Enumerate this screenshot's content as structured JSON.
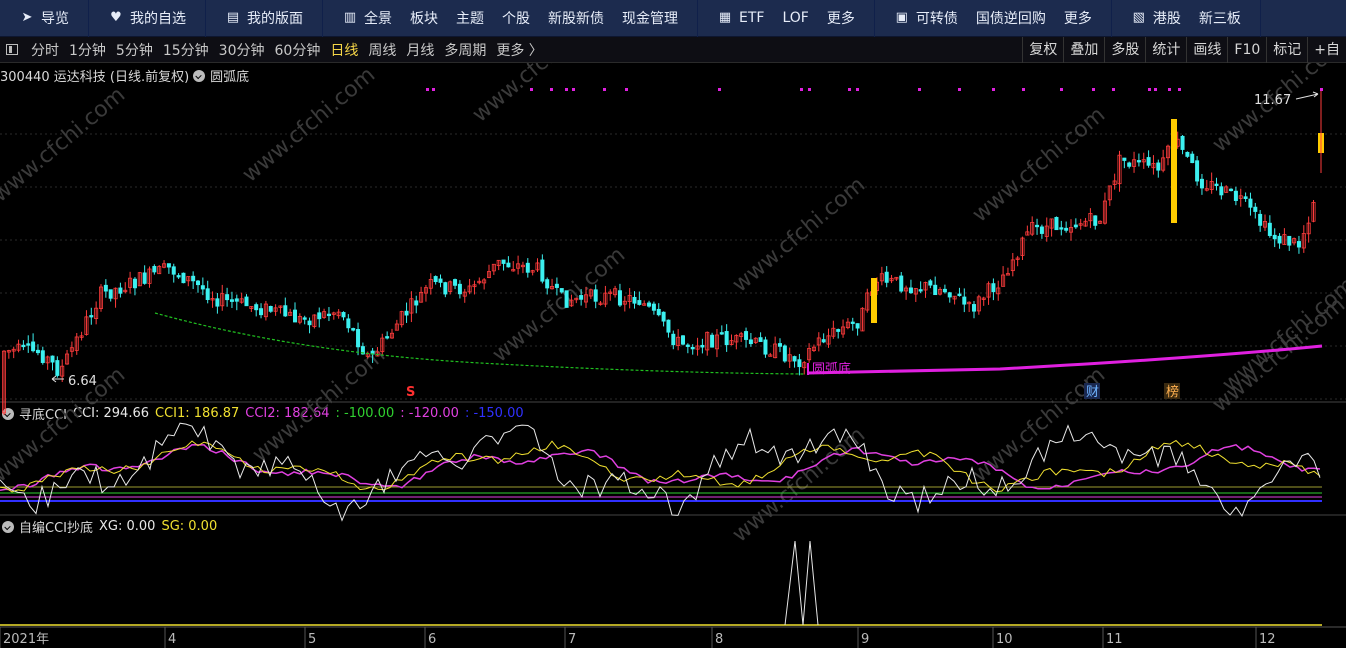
{
  "topnav": {
    "groups": [
      [
        {
          "label": "导览",
          "icon": "paper-plane-icon"
        }
      ],
      [
        {
          "label": "我的自选",
          "icon": "heart-icon"
        }
      ],
      [
        {
          "label": "我的版面",
          "icon": "layout-icon"
        }
      ],
      [
        {
          "label": "全景",
          "icon": "chart-board-icon"
        },
        {
          "label": "板块"
        },
        {
          "label": "主题"
        },
        {
          "label": "个股"
        },
        {
          "label": "新股新债"
        },
        {
          "label": "现金管理"
        }
      ],
      [
        {
          "label": "ETF",
          "icon": "bar-chart-icon"
        },
        {
          "label": "LOF"
        },
        {
          "label": "更多"
        }
      ],
      [
        {
          "label": "可转债",
          "icon": "bond-icon"
        },
        {
          "label": "国债逆回购"
        },
        {
          "label": "更多"
        }
      ],
      [
        {
          "label": "港股",
          "icon": "hk-icon"
        },
        {
          "label": "新三板"
        }
      ]
    ]
  },
  "periodbar": {
    "periods": [
      "分时",
      "1分钟",
      "5分钟",
      "15分钟",
      "30分钟",
      "60分钟",
      "日线",
      "周线",
      "月线",
      "多周期",
      "更多 〉"
    ],
    "active": "日线",
    "tools": [
      "复权",
      "叠加",
      "多股",
      "统计",
      "画线",
      "F10",
      "标记",
      "+自"
    ]
  },
  "main_panel": {
    "title": "300440 运达科技 (日线.前复权)",
    "indicator": "圆弧底",
    "high_label": "11.67",
    "low_label": "6.64",
    "arc_label": "圆弧底",
    "marker_s": "S",
    "marker_cai": "财",
    "marker_bang": "榜"
  },
  "cci_panel": {
    "name": "寻底CCI",
    "items": [
      {
        "text": "CCI: 294.66",
        "color": "#e8e8e8"
      },
      {
        "text": "CCI1: 186.87",
        "color": "#f0e030"
      },
      {
        "text": "CCI2: 182.64",
        "color": "#e040e0"
      },
      {
        "text": ": -100.00",
        "color": "#30d030"
      },
      {
        "text": ": -120.00",
        "color": "#e040e0"
      },
      {
        "text": ": -150.00",
        "color": "#3030ff"
      }
    ]
  },
  "xg_panel": {
    "name": "自编CCI抄底",
    "items": [
      {
        "text": "XG: 0.00",
        "color": "#e8e8e8"
      },
      {
        "text": "SG: 0.00",
        "color": "#f0e030"
      }
    ]
  },
  "xaxis": {
    "labels": [
      "2021年",
      "4",
      "5",
      "6",
      "7",
      "8",
      "9",
      "10",
      "11",
      "12"
    ]
  },
  "watermark": "www.cfchi.com",
  "colors": {
    "up": "#ff3c3c",
    "down": "#3cf0f0",
    "highlight": "#ffcc00",
    "arc": "#e020e0",
    "dashed": "#20c020"
  }
}
